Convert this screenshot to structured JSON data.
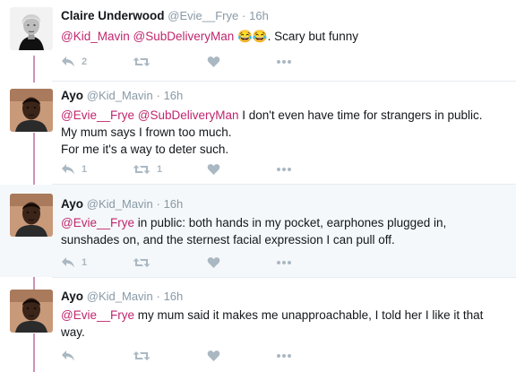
{
  "tweets": [
    {
      "name": "Claire Underwood",
      "handle": "@Evie__Frye",
      "sep": "·",
      "time": "16h",
      "mentions": [
        "@Kid_Mavin",
        "@SubDeliveryMan"
      ],
      "emoji": "😂😂",
      "text_after": ". Scary but funny",
      "reply_count": "2",
      "retweet_count": "",
      "avatar": "woman-portrait-bw"
    },
    {
      "name": "Ayo",
      "handle": "@Kid_Mavin",
      "sep": "·",
      "time": "16h",
      "mentions": [
        "@Evie__Frye",
        "@SubDeliveryMan"
      ],
      "text_lines": [
        "I don't even have time for strangers in public.",
        "My mum says I frown too much.",
        "For me it's a way to deter such."
      ],
      "reply_count": "1",
      "retweet_count": "1",
      "avatar": "man-portrait"
    },
    {
      "name": "Ayo",
      "handle": "@Kid_Mavin",
      "sep": "·",
      "time": "16h",
      "mentions": [
        "@Evie__Frye"
      ],
      "text_lines": [
        " in public: both hands in my pocket, earphones plugged in,",
        "sunshades on, and the sternest facial expression I can pull off."
      ],
      "reply_count": "1",
      "retweet_count": "",
      "avatar": "man-portrait"
    },
    {
      "name": "Ayo",
      "handle": "@Kid_Mavin",
      "sep": "·",
      "time": "16h",
      "mentions": [
        "@Evie__Frye"
      ],
      "text_lines": [
        " my mum said it makes me unapproachable, I told her I like it that",
        "way."
      ],
      "reply_count": "",
      "retweet_count": "",
      "avatar": "man-portrait"
    }
  ],
  "icons": {
    "reply": "reply-icon",
    "retweet": "retweet-icon",
    "like": "heart-icon",
    "more": "more-dots-icon"
  },
  "colors": {
    "mention": "#c0266e",
    "thread_line": "#cf91b5",
    "icon": "#aab8c2",
    "highlight_bg": "#f5f8fa"
  }
}
